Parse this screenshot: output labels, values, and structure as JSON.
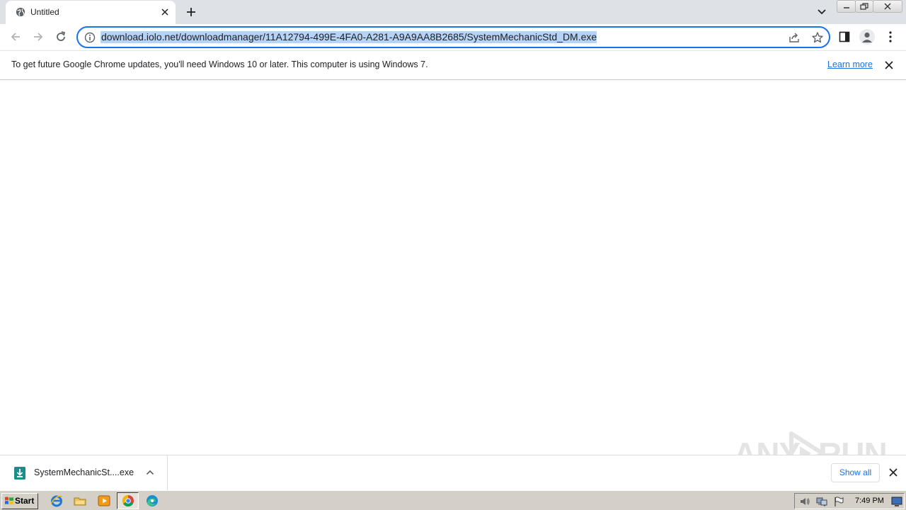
{
  "tab": {
    "title": "Untitled"
  },
  "omnibox": {
    "url": "download.iolo.net/downloadmanager/11A12794-499E-4FA0-A281-A9A9AA8B2685/SystemMechanicStd_DM.exe"
  },
  "infobar": {
    "message": "To get future Google Chrome updates, you'll need Windows 10 or later. This computer is using Windows 7.",
    "learn_more": "Learn more"
  },
  "download_shelf": {
    "file_name": "SystemMechanicSt....exe",
    "show_all": "Show all"
  },
  "watermark": {
    "text_left": "ANY",
    "text_right": "RUN"
  },
  "taskbar": {
    "start_label": "Start",
    "clock": "7:49 PM"
  },
  "colors": {
    "accent": "#1a73e8",
    "selection": "#b5d2f7",
    "tabstrip": "#dee1e6",
    "taskbar": "#d4d0c8",
    "download_icon": "#1a8f8a"
  }
}
